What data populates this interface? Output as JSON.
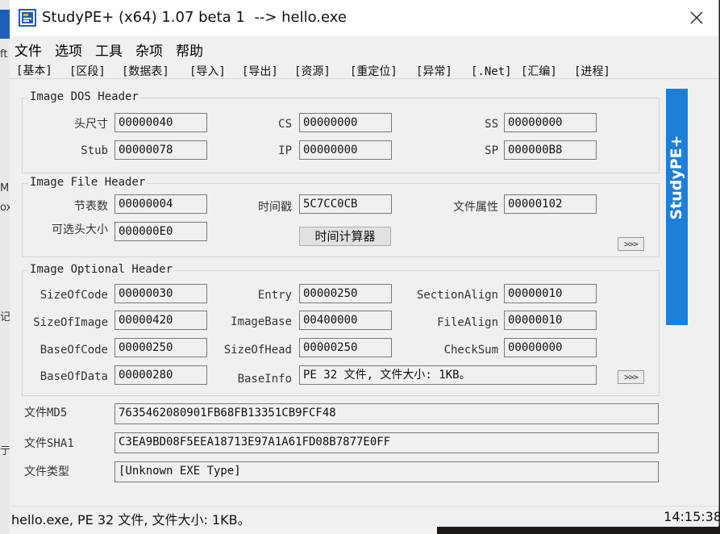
{
  "window": {
    "title": "StudyPE+ (x64) 1.07 beta 1  --> hello.exe"
  },
  "menu": [
    "文件",
    "选项",
    "工具",
    "杂项",
    "帮助"
  ],
  "tabs": [
    "[基本]",
    "[区段]",
    "[数据表]",
    "[导入]",
    "[导出]",
    "[资源]",
    "[重定位]",
    "[异常]",
    "[.Net]",
    "[汇编]",
    "[进程]"
  ],
  "dos_header": {
    "title": "Image DOS Header",
    "head_size": {
      "label": "头尺寸",
      "value": "00000040"
    },
    "stub": {
      "label": "Stub",
      "value": "00000078"
    },
    "cs": {
      "label": "CS",
      "value": "00000000"
    },
    "ip": {
      "label": "IP",
      "value": "00000000"
    },
    "ss": {
      "label": "SS",
      "value": "00000000"
    },
    "sp": {
      "label": "SP",
      "value": "000000B8"
    }
  },
  "file_header": {
    "title": "Image File Header",
    "sections": {
      "label": "节表数",
      "value": "00000004"
    },
    "optional_size": {
      "label": "可选头大小",
      "value": "000000E0"
    },
    "timestamp": {
      "label": "时间戳",
      "value": "5C7CC0CB"
    },
    "time_calc_button": "时间计算器",
    "attributes": {
      "label": "文件属性",
      "value": "00000102"
    },
    "more_button": ">>>"
  },
  "optional_header": {
    "title": "Image Optional Header",
    "size_of_code": {
      "label": "SizeOfCode",
      "value": "00000030"
    },
    "size_of_image": {
      "label": "SizeOfImage",
      "value": "00000420"
    },
    "base_of_code": {
      "label": "BaseOfCode",
      "value": "00000250"
    },
    "base_of_data": {
      "label": "BaseOfData",
      "value": "00000280"
    },
    "entry": {
      "label": "Entry",
      "value": "00000250"
    },
    "image_base": {
      "label": "ImageBase",
      "value": "00400000"
    },
    "size_of_head": {
      "label": "SizeOfHead",
      "value": "00000250"
    },
    "base_info": {
      "label": "BaseInfo",
      "value": "PE 32 文件, 文件大小: 1KB。"
    },
    "section_align": {
      "label": "SectionAlign",
      "value": "00000010"
    },
    "file_align": {
      "label": "FileAlign",
      "value": "00000010"
    },
    "checksum": {
      "label": "CheckSum",
      "value": "00000000"
    },
    "more_button": ">>>"
  },
  "hashes": {
    "md5": {
      "label": "文件MD5",
      "value": "7635462080901FB68FB13351CB9FCF48"
    },
    "sha1": {
      "label": "文件SHA1",
      "value": "C3EA9BD08F5EEA18713E97A1A61FD08B7877E0FF"
    },
    "type": {
      "label": "文件类型",
      "value": "[Unknown EXE Type]"
    }
  },
  "side_banner": "StudyPE+",
  "status": {
    "left": "hello.exe, PE 32 文件, 文件大小: 1KB。",
    "time": "14:15:38"
  },
  "desktop_fragments": [
    "ft",
    "M",
    "ox",
    "记",
    "亍"
  ],
  "colors": {
    "banner": "#1e7fd8",
    "window_bg": "#f0f0f0",
    "app_icon_blue": "#1c5fb8"
  },
  "icons": {
    "app": "studype-app-icon",
    "close": "close-icon"
  }
}
